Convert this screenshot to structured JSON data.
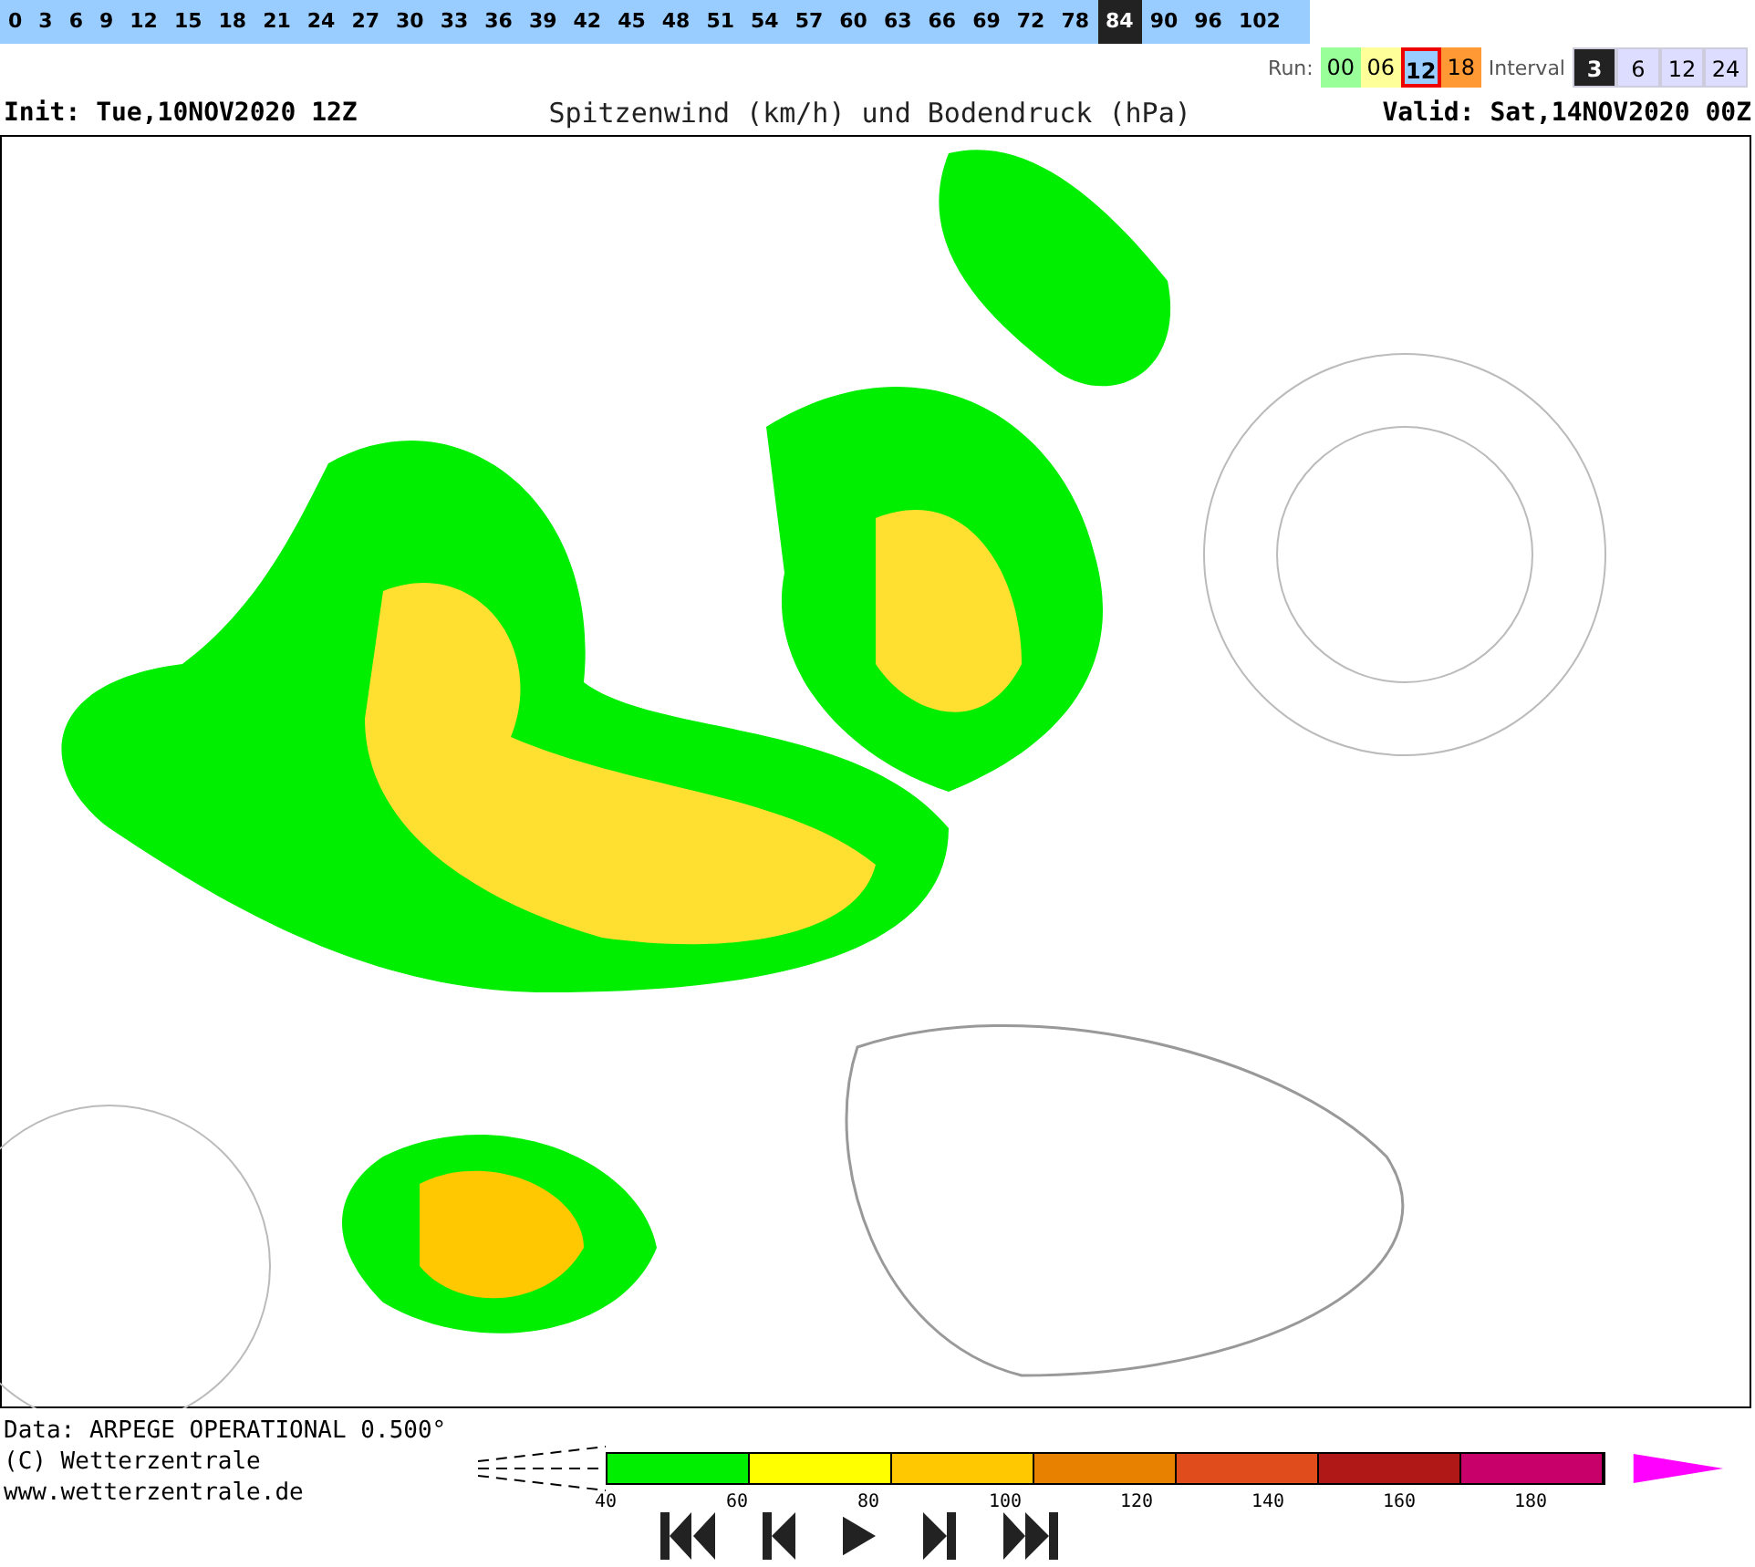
{
  "timesteps": [
    {
      "label": "0",
      "selected": false
    },
    {
      "label": "3",
      "selected": false
    },
    {
      "label": "6",
      "selected": false
    },
    {
      "label": "9",
      "selected": false
    },
    {
      "label": "12",
      "selected": false
    },
    {
      "label": "15",
      "selected": false
    },
    {
      "label": "18",
      "selected": false
    },
    {
      "label": "21",
      "selected": false
    },
    {
      "label": "24",
      "selected": false
    },
    {
      "label": "27",
      "selected": false
    },
    {
      "label": "30",
      "selected": false
    },
    {
      "label": "33",
      "selected": false
    },
    {
      "label": "36",
      "selected": false
    },
    {
      "label": "39",
      "selected": false
    },
    {
      "label": "42",
      "selected": false
    },
    {
      "label": "45",
      "selected": false
    },
    {
      "label": "48",
      "selected": false
    },
    {
      "label": "51",
      "selected": false
    },
    {
      "label": "54",
      "selected": false
    },
    {
      "label": "57",
      "selected": false
    },
    {
      "label": "60",
      "selected": false
    },
    {
      "label": "63",
      "selected": false
    },
    {
      "label": "66",
      "selected": false
    },
    {
      "label": "69",
      "selected": false
    },
    {
      "label": "72",
      "selected": false
    },
    {
      "label": "78",
      "selected": false
    },
    {
      "label": "84",
      "selected": true
    },
    {
      "label": "90",
      "selected": false
    },
    {
      "label": "96",
      "selected": false
    },
    {
      "label": "102",
      "selected": false
    }
  ],
  "run": {
    "label": "Run:",
    "options": [
      {
        "label": "00",
        "color": "#99ff99",
        "selected": false
      },
      {
        "label": "06",
        "color": "#ffff99",
        "selected": false
      },
      {
        "label": "12",
        "color": "#99ccff",
        "selected": true
      },
      {
        "label": "18",
        "color": "#ff9933",
        "selected": false
      }
    ]
  },
  "interval": {
    "label": "Interval",
    "options": [
      {
        "label": "3",
        "selected": true
      },
      {
        "label": "6",
        "selected": false
      },
      {
        "label": "12",
        "selected": false
      },
      {
        "label": "24",
        "selected": false
      }
    ]
  },
  "header": {
    "init": "Init: Tue,10NOV2020 12Z",
    "title": "Spitzenwind (km/h) und Bodendruck (hPa)",
    "valid": "Valid: Sat,14NOV2020 00Z"
  },
  "footer": {
    "lines": [
      "Data: ARPEGE OPERATIONAL 0.500°",
      "(C) Wetterzentrale",
      "www.wetterzentrale.de"
    ]
  },
  "legend": {
    "segments": [
      {
        "color": "#00ee00"
      },
      {
        "color": "#ffff00"
      },
      {
        "color": "#ffc800"
      },
      {
        "color": "#e88000"
      },
      {
        "color": "#e04c1c"
      },
      {
        "color": "#b01818"
      },
      {
        "color": "#c8006a"
      }
    ],
    "labels": [
      "40",
      "60",
      "80",
      "100",
      "120",
      "140",
      "160",
      "180"
    ]
  }
}
